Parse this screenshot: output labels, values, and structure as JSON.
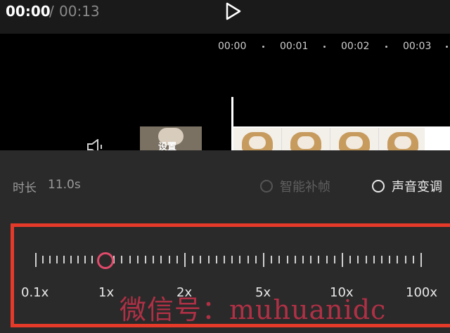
{
  "player": {
    "current_time": "00:00",
    "separator": "/",
    "total_time": "00:13"
  },
  "timeline": {
    "ruler": [
      "00:00",
      "00:01",
      "00:02",
      "00:03"
    ],
    "cover_label": "设置"
  },
  "panel": {
    "duration_label": "时长",
    "duration_value": "11.0s",
    "option_smooth": "智能补帧",
    "option_pitch": "声音变调"
  },
  "speed": {
    "labels": [
      "0.1x",
      "1x",
      "2x",
      "5x",
      "10x",
      "100x"
    ],
    "selected": "1x"
  },
  "watermark": "微信号：muhuanidc",
  "colors": {
    "accent_border": "#e53a2a",
    "knob": "#e14a6b"
  }
}
